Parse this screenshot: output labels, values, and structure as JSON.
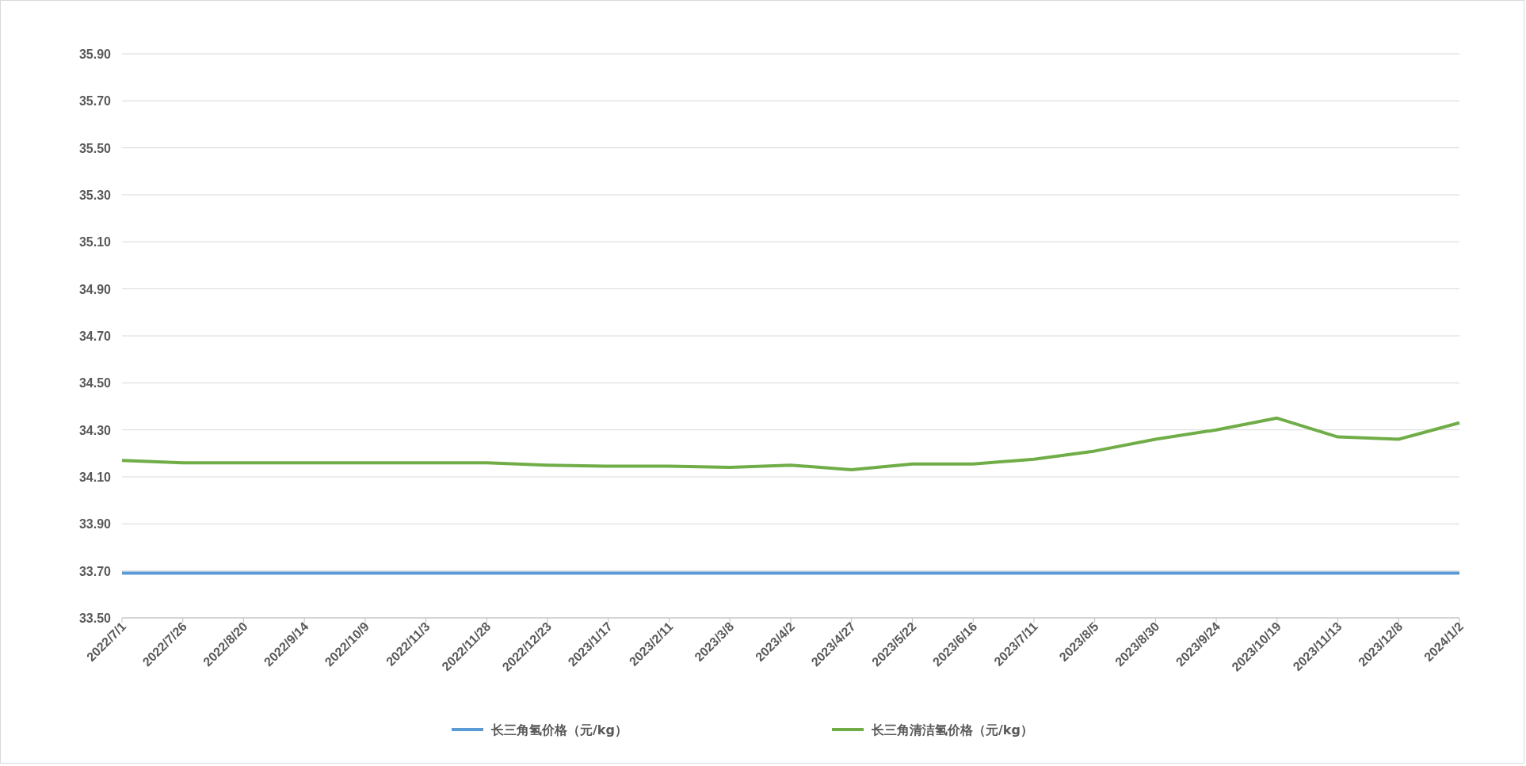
{
  "chart": {
    "chart_data": {
      "type": "line",
      "grid": true,
      "legend": "bottom",
      "categories": [
        "2022/7/1",
        "2022/7/26",
        "2022/8/20",
        "2022/9/14",
        "2022/10/9",
        "2022/11/3",
        "2022/11/28",
        "2022/12/23",
        "2023/1/17",
        "2023/2/11",
        "2023/3/8",
        "2023/4/2",
        "2023/4/27",
        "2023/5/22",
        "2023/6/16",
        "2023/7/11",
        "2023/8/5",
        "2023/8/30",
        "2023/9/24",
        "2023/10/19",
        "2023/11/13",
        "2023/12/8",
        "2024/1/2"
      ],
      "series": [
        {
          "name": "长三角氢价格（元/kg）",
          "color": "#5b9bd5",
          "values": [
            33.69,
            33.69,
            33.69,
            33.69,
            33.69,
            33.69,
            33.69,
            33.69,
            33.69,
            33.69,
            33.69,
            33.69,
            33.69,
            33.69,
            33.69,
            33.69,
            33.69,
            33.69,
            33.69,
            33.69,
            33.69,
            33.69,
            33.69
          ]
        },
        {
          "name": "长三角清洁氢价格（元/kg）",
          "color": "#70ad47",
          "values": [
            34.17,
            34.16,
            34.16,
            34.16,
            34.16,
            34.16,
            34.16,
            34.15,
            34.145,
            34.145,
            34.14,
            34.15,
            34.13,
            34.155,
            34.155,
            34.175,
            34.21,
            34.26,
            34.3,
            34.35,
            34.27,
            34.26,
            34.33
          ]
        }
      ],
      "ylim": [
        33.5,
        35.9
      ],
      "yticks": [
        {
          "value": 33.5,
          "label": "33.50"
        },
        {
          "value": 33.7,
          "label": "33.70"
        },
        {
          "value": 33.9,
          "label": "33.90"
        },
        {
          "value": 34.1,
          "label": "34.10"
        },
        {
          "value": 34.3,
          "label": "34.30"
        },
        {
          "value": 34.5,
          "label": "34.50"
        },
        {
          "value": 34.7,
          "label": "34.70"
        },
        {
          "value": 34.9,
          "label": "34.90"
        },
        {
          "value": 35.1,
          "label": "35.10"
        },
        {
          "value": 35.3,
          "label": "35.30"
        },
        {
          "value": 35.5,
          "label": "35.50"
        },
        {
          "value": 35.7,
          "label": "35.70"
        },
        {
          "value": 35.9,
          "label": "35.90"
        }
      ]
    }
  }
}
